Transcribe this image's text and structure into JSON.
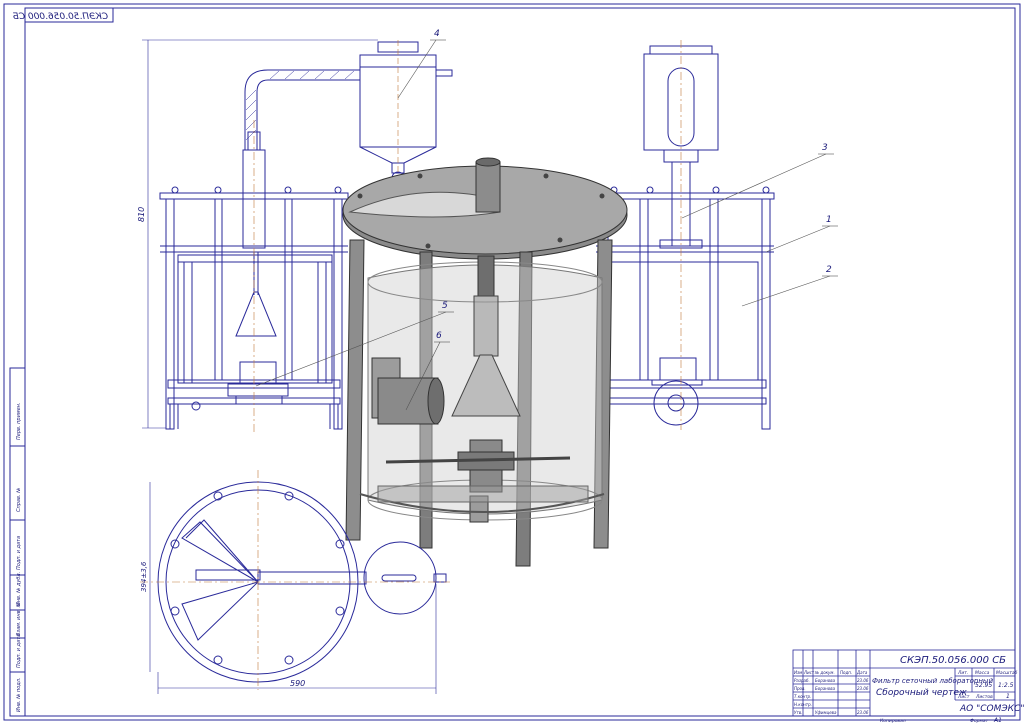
{
  "doc": {
    "code": "СКЭП.50.056.000 СБ",
    "code_mirrored": "СКЭП.50.056.000 СБ",
    "title_line1": "Фильтр сеточный лабораторный",
    "title_line2": "Сборочный чертеж",
    "company": "АО \"СОМЭКС\"",
    "mass": "52.95",
    "scale": "1:2.5",
    "sheet_label": "Лист",
    "sheets_label": "Листов",
    "sheets_count": "1",
    "mass_label": "Масса",
    "scale_label": "Масштаб",
    "lit_label": "Лит.",
    "format_label": "Формат",
    "format_value": "А1",
    "copied_label": "Копировал",
    "colors": {
      "frame": "#2a2a9a",
      "text": "#1a1a7a",
      "model": "#7a7a7a"
    }
  },
  "titleblock": {
    "headers": [
      "Изм",
      "Лист",
      "№ докум.",
      "Подп.",
      "Дата"
    ],
    "rows": [
      {
        "role": "Разраб.",
        "name": "Боранова",
        "date": "23.06"
      },
      {
        "role": "Пров.",
        "name": "Боранова",
        "date": "23.06"
      },
      {
        "role": "Т.контр.",
        "name": "",
        "date": ""
      },
      {
        "role": "Н.контр.",
        "name": "",
        "date": ""
      },
      {
        "role": "Утв.",
        "name": "Уфимцева",
        "date": "23.06"
      }
    ]
  },
  "side_stamp": [
    "Перв. примен.",
    "Справ. №",
    "Подп. и дата",
    "Инв. № дубл.",
    "Взам. инв. №",
    "Подп. и дата",
    "Инв. № подл."
  ],
  "callouts": [
    "1",
    "2",
    "3",
    "4",
    "5",
    "6"
  ],
  "dimensions": {
    "height": "810",
    "width": "590",
    "plan_note": "394±3,6"
  }
}
